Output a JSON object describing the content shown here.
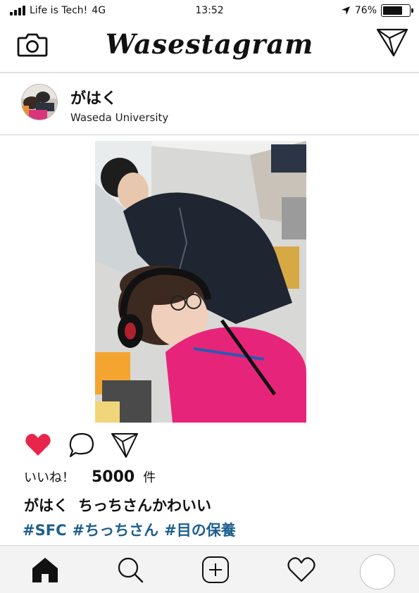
{
  "status_bar": {
    "carrier": "Life is Tech!",
    "network": "4G",
    "time": "13:52",
    "battery_percent": "76%",
    "battery_level": 0.76
  },
  "header": {
    "title": "Wasestagram",
    "icons": {
      "left": "camera-icon",
      "right": "send-icon"
    }
  },
  "post": {
    "username": "がはく",
    "location": "Waseda University",
    "liked": true,
    "likes_label": "いいね！",
    "likes_count": "5000",
    "likes_unit": "件",
    "caption_user": "がはく",
    "caption_text": "ちっちさんかわいい",
    "hashtags": [
      "#SFC",
      "#ちっちさん",
      "#目の保養"
    ],
    "action_icons": [
      "heart-icon",
      "comment-icon",
      "share-icon"
    ],
    "colors": {
      "like": "#e8264b",
      "hashtag": "#1d5f8f"
    }
  },
  "tab_bar": {
    "icons": [
      "home-icon",
      "search-icon",
      "add-post-icon",
      "activity-icon",
      "profile-icon"
    ]
  }
}
